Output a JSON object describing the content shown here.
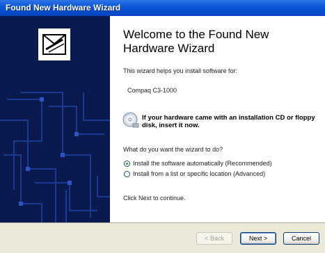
{
  "window": {
    "title": "Found New Hardware Wizard"
  },
  "content": {
    "heading": "Welcome to the Found New Hardware Wizard",
    "intro": "This wizard helps you install software for:",
    "device_name": "Compaq C3-1000",
    "cd_note": "If your hardware came with an installation CD or floppy disk, insert it now.",
    "question": "What do you want the wizard to do?",
    "options": [
      {
        "label": "Install the software automatically (Recommended)",
        "selected": true
      },
      {
        "label": "Install from a list or specific location (Advanced)",
        "selected": false
      }
    ],
    "footer_text": "Click Next to continue."
  },
  "buttons": {
    "back": "< Back",
    "next": "Next >",
    "cancel": "Cancel"
  },
  "icons": {
    "side_graphic": "hardware-box-icon",
    "cd": "cd-disk-icon"
  },
  "colors": {
    "title_bar": "#0a54d6",
    "side_panel": "#0a1a4e",
    "button_bar": "#ece9d8"
  }
}
